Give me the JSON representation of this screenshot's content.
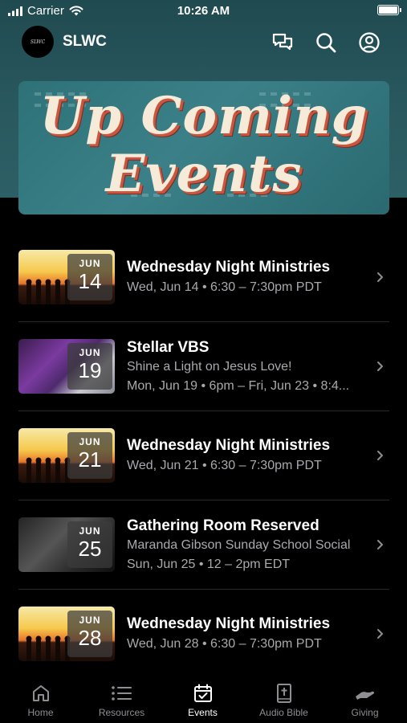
{
  "status_bar": {
    "carrier": "Carrier",
    "time": "10:26 AM"
  },
  "header": {
    "logo_text": "SLWC",
    "title": "SLWC"
  },
  "banner": {
    "line1": "Up Coming",
    "line2": "Events"
  },
  "events": [
    {
      "month": "JUN",
      "day": "14",
      "title": "Wednesday Night Ministries",
      "line1": "Wed, Jun 14 • 6:30 – 7:30pm PDT",
      "line2": ""
    },
    {
      "month": "JUN",
      "day": "19",
      "title": "Stellar VBS",
      "line1": "Shine a Light on Jesus Love!",
      "line2": "Mon, Jun 19 • 6pm – Fri, Jun 23 • 8:4..."
    },
    {
      "month": "JUN",
      "day": "21",
      "title": "Wednesday Night Ministries",
      "line1": "Wed, Jun 21 • 6:30 – 7:30pm PDT",
      "line2": ""
    },
    {
      "month": "JUN",
      "day": "25",
      "title": "Gathering Room Reserved",
      "line1": "Maranda Gibson Sunday School Social",
      "line2": "Sun, Jun 25 • 12 – 2pm EDT"
    },
    {
      "month": "JUN",
      "day": "28",
      "title": "Wednesday Night Ministries",
      "line1": "Wed, Jun 28 • 6:30 – 7:30pm PDT",
      "line2": ""
    }
  ],
  "tabs": [
    {
      "label": "Home",
      "icon": "home-icon"
    },
    {
      "label": "Resources",
      "icon": "list-icon"
    },
    {
      "label": "Events",
      "icon": "calendar-check-icon"
    },
    {
      "label": "Audio Bible",
      "icon": "bible-icon"
    },
    {
      "label": "Giving",
      "icon": "giving-hand-icon"
    }
  ],
  "active_tab": "Events"
}
